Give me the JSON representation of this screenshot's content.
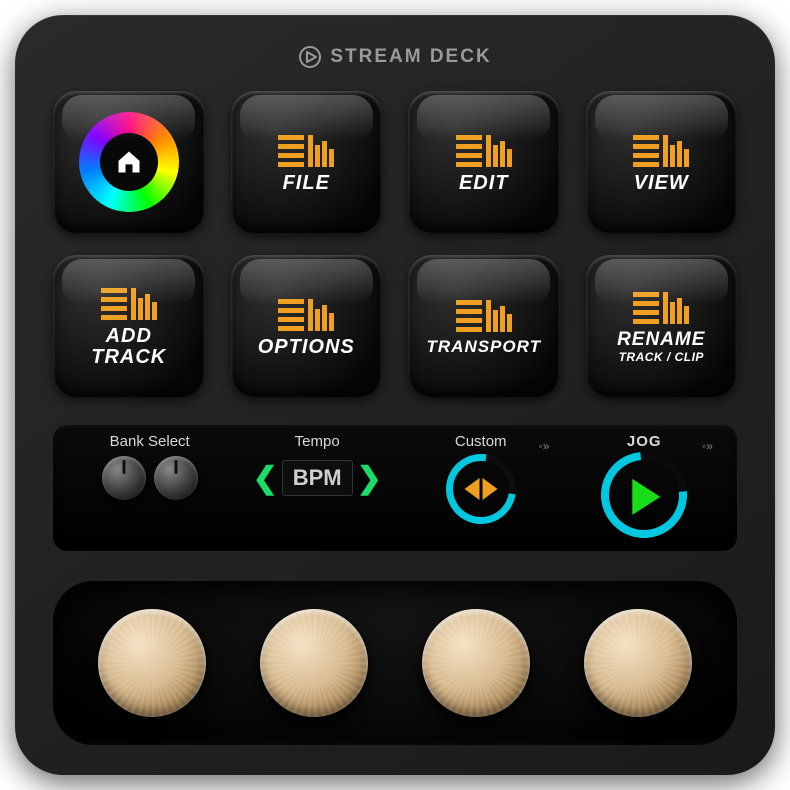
{
  "brand": "STREAM DECK",
  "keys": [
    {
      "id": "home",
      "type": "rainbow-home",
      "label": "",
      "sublabel": ""
    },
    {
      "id": "file",
      "type": "eq",
      "label": "FILE",
      "sublabel": ""
    },
    {
      "id": "edit",
      "type": "eq",
      "label": "EDIT",
      "sublabel": ""
    },
    {
      "id": "view",
      "type": "eq",
      "label": "VIEW",
      "sublabel": ""
    },
    {
      "id": "add-track",
      "type": "eq",
      "label": "ADD\nTRACK",
      "sublabel": ""
    },
    {
      "id": "options",
      "type": "eq",
      "label": "OPTIONS",
      "sublabel": ""
    },
    {
      "id": "transport",
      "type": "eq",
      "label": "TRANSPORT",
      "sublabel": ""
    },
    {
      "id": "rename",
      "type": "eq",
      "label": "RENAME",
      "sublabel": "TRACK / CLIP"
    }
  ],
  "strip": {
    "bank": {
      "title": "Bank Select"
    },
    "tempo": {
      "title": "Tempo",
      "value": "BPM"
    },
    "custom": {
      "title": "Custom"
    },
    "jog": {
      "title": "JOG"
    }
  },
  "knob_count": 4
}
